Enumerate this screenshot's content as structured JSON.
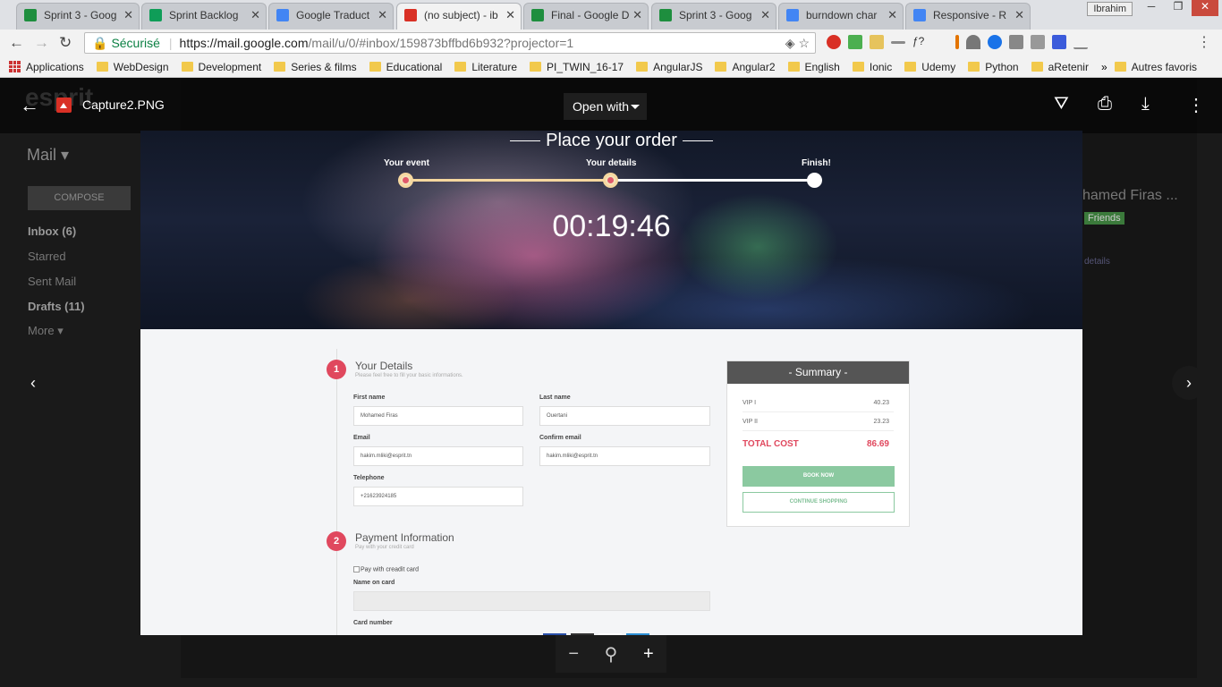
{
  "browser": {
    "tabs": [
      {
        "label": "Sprint 3 - Goog",
        "active": false
      },
      {
        "label": "Sprint Backlog",
        "active": false
      },
      {
        "label": "Google Traduct",
        "active": false
      },
      {
        "label": "(no subject) - ib",
        "active": true
      },
      {
        "label": "Final - Google D",
        "active": false
      },
      {
        "label": "Sprint 3 - Goog",
        "active": false
      },
      {
        "label": "burndown char",
        "active": false
      },
      {
        "label": "Responsive - R",
        "active": false
      }
    ],
    "user": "Ibrahim",
    "secure_label": "Sécurisé",
    "url_host": "https://mail.google.com",
    "url_path": "/mail/u/0/#inbox/159873bffbd6b932?projector=1",
    "bookmarks": [
      "Applications",
      "WebDesign",
      "Development",
      "Series & films",
      "Educational",
      "Literature",
      "PI_TWIN_16-17",
      "AngularJS",
      "Angular2",
      "English",
      "Ionic",
      "Udemy",
      "Python",
      "aRetenir"
    ],
    "bookmarks_more": "»",
    "other_bookmarks": "Autres favoris"
  },
  "gmail_background": {
    "logo": "esprit",
    "mail_label": "Mail ▾",
    "compose": "COMPOSE",
    "nav": [
      "Inbox (6)",
      "Starred",
      "Sent Mail",
      "Drafts (11)",
      "More ▾"
    ],
    "sender_fragment": "hamed Firas ...",
    "friends_label": "Friends",
    "details_link": "details"
  },
  "viewer": {
    "filename": "Capture2.PNG",
    "open_with": "Open with"
  },
  "screenshot": {
    "hero_title": "Place your order",
    "steps": [
      "Your event",
      "Your details",
      "Finish!"
    ],
    "timer": "00:19:46",
    "details": {
      "number": "1",
      "title": "Your Details",
      "subtitle": "Please feel free to fill your basic informations.",
      "first_name_label": "First name",
      "first_name": "Mohamed Firas",
      "last_name_label": "Last name",
      "last_name": "Ouertani",
      "email_label": "Email",
      "email": "hakim.mliki@esprit.tn",
      "confirm_label": "Confirm email",
      "confirm_email": "hakim.mliki@esprit.tn",
      "phone_label": "Telephone",
      "phone": "+21623924185"
    },
    "payment": {
      "number": "2",
      "title": "Payment Information",
      "subtitle": "Pay with your credit card",
      "checkbox": "Pay with creadit card",
      "name_label": "Name on card",
      "card_label": "Card number"
    },
    "summary": {
      "title": "- Summary -",
      "rows": [
        {
          "label": "VIP I",
          "value": "40.23"
        },
        {
          "label": "VIP II",
          "value": "23.23"
        }
      ],
      "total_label": "TOTAL COST",
      "total_value": "86.69",
      "book": "BOOK NOW",
      "continue": "CONTINUE SHOPPING"
    }
  },
  "colors": {
    "accent": "#e0485e",
    "book_button": "#8bc9a0",
    "summary_header": "#555555"
  }
}
